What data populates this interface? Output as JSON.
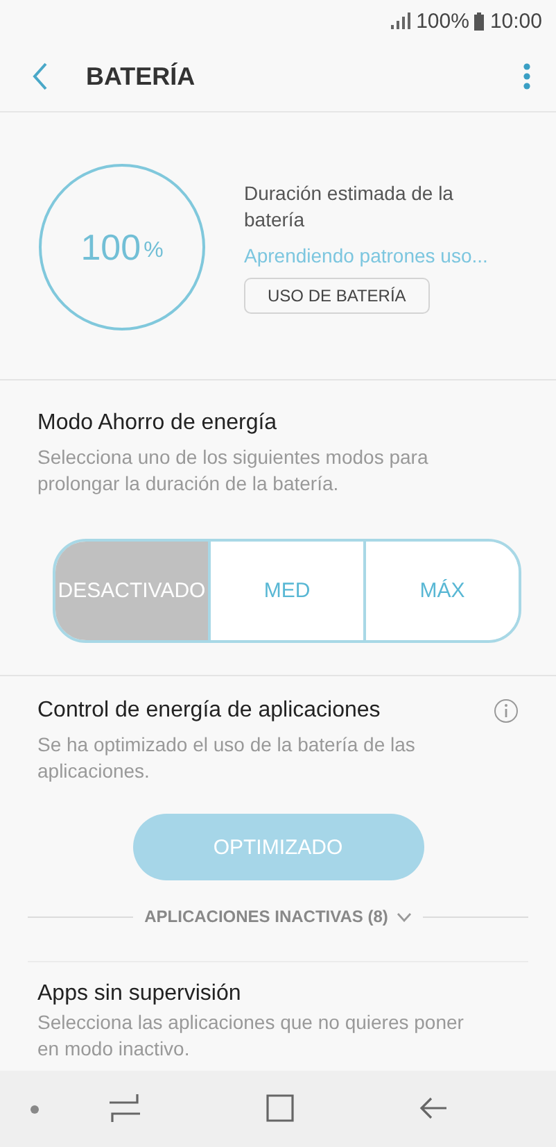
{
  "status_bar": {
    "battery": "100%",
    "time": "10:00"
  },
  "header": {
    "title": "BATERÍA"
  },
  "battery": {
    "percent": "100",
    "unit": "%",
    "estimate_label": "Duración estimada de la batería",
    "estimate_value": "Aprendiendo patrones uso...",
    "usage_button": "USO DE BATERÍA"
  },
  "power_saving": {
    "title": "Modo Ahorro de energía",
    "description": "Selecciona uno de los siguientes modos para prolongar la duración de la batería.",
    "modes": [
      {
        "label": "DESACTIVADO",
        "selected": true
      },
      {
        "label": "MED",
        "selected": false
      },
      {
        "label": "MÁX",
        "selected": false
      }
    ]
  },
  "app_power": {
    "title": "Control de energía de aplicaciones",
    "description": "Se ha optimizado el uso de la batería de las aplicaciones.",
    "button": {
      "label": "OPTIMIZADO",
      "disabled": true
    }
  },
  "inactive_apps": {
    "label": "APLICACIONES INACTIVAS (8)",
    "expanded": false
  },
  "unmonitored": {
    "title": "Apps sin supervisión",
    "description": "Selecciona las aplicaciones que no quieres poner en modo inactivo."
  }
}
